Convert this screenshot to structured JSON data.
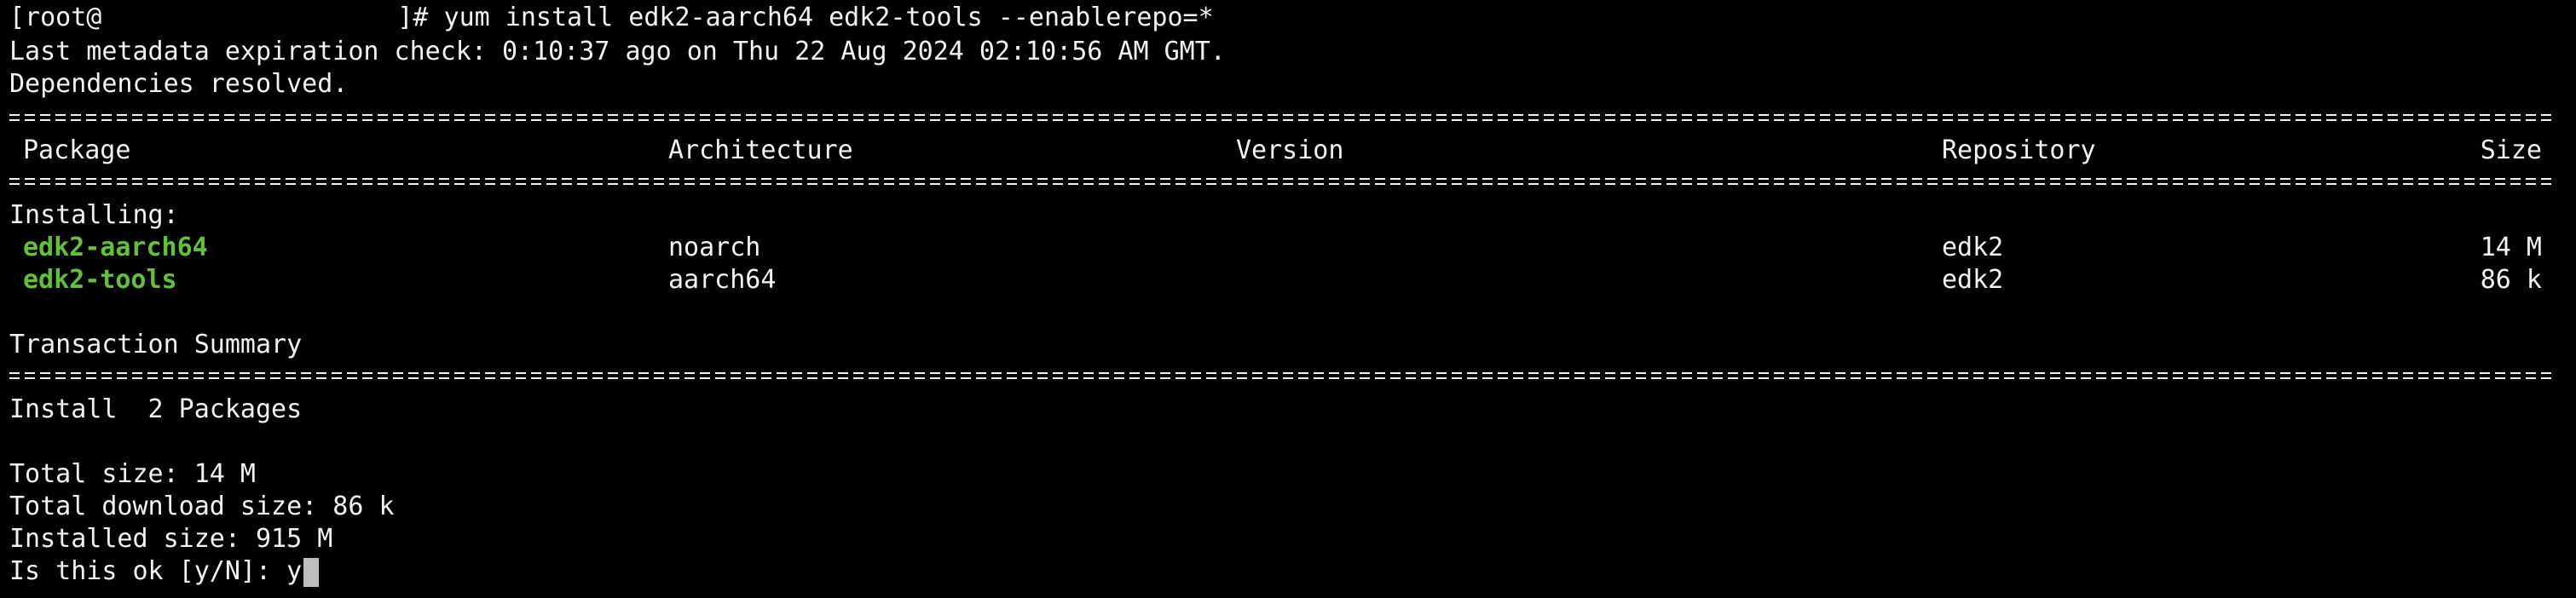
{
  "terminal": {
    "prompt_user": "[root@",
    "prompt_suffix": "]# ",
    "command": "yum install edk2-aarch64 edk2-tools --enablerepo=*",
    "metadata_line": "Last metadata expiration check: 0:10:37 ago on Thu 22 Aug 2024 02:10:56 AM GMT.",
    "deps_line": "Dependencies resolved.",
    "table": {
      "headers": {
        "package": "Package",
        "architecture": "Architecture",
        "version": "Version",
        "repository": "Repository",
        "size": "Size"
      },
      "section_label": "Installing:",
      "rows": [
        {
          "package": "edk2-aarch64",
          "arch": "noarch",
          "version": "",
          "repo": "edk2",
          "size": "14 M"
        },
        {
          "package": "edk2-tools",
          "arch": "aarch64",
          "version": "",
          "repo": "edk2",
          "size": "86 k"
        }
      ]
    },
    "summary_title": "Transaction Summary",
    "install_line": "Install  2 Packages",
    "total_size": "Total size: 14 M",
    "total_download": "Total download size: 86 k",
    "installed_size": "Installed size: 915 M",
    "confirm_prompt": "Is this ok [y/N]: ",
    "confirm_input": "y"
  },
  "colors": {
    "background": "#000000",
    "text": "#f2f2f2",
    "package_name": "#5fc23a",
    "cursor": "#bdbdbd"
  }
}
